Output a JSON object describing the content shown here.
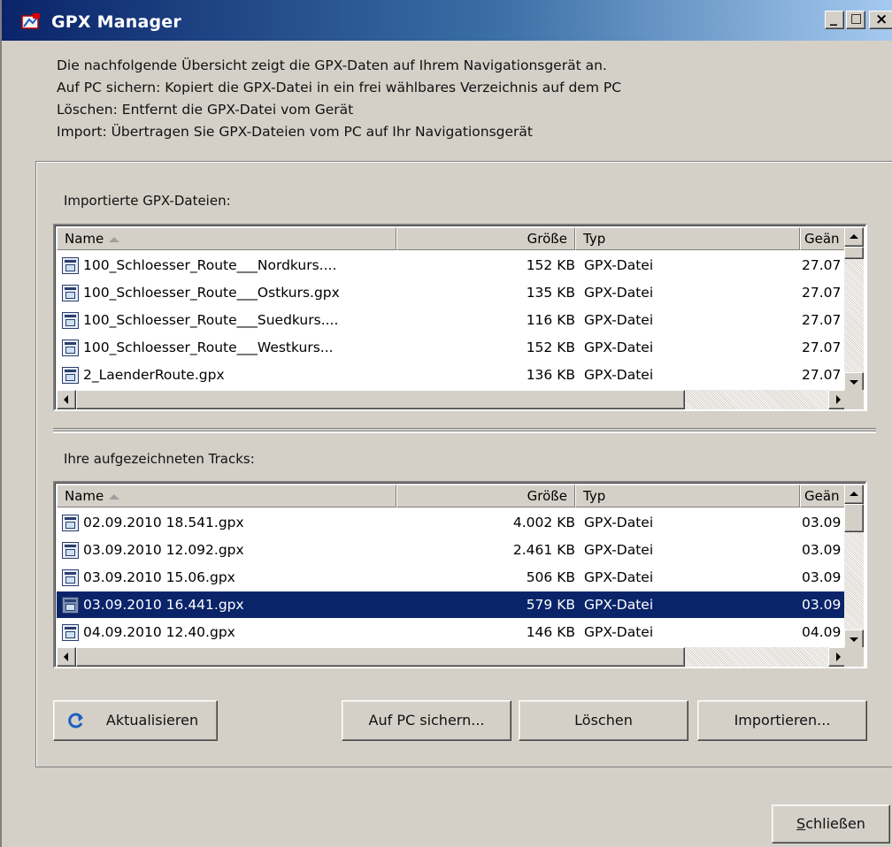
{
  "window": {
    "title": "GPX Manager",
    "controls": {
      "minimize": "_",
      "maximize": "□",
      "close": "×"
    }
  },
  "intro": {
    "lines": [
      "Die nachfolgende Übersicht zeigt die GPX-Daten auf Ihrem Navigationsgerät an.",
      "Auf PC sichern: Kopiert die GPX-Datei in ein frei wählbares Verzeichnis auf dem PC",
      "Löschen: Entfernt die GPX-Datei vom Gerät",
      "Import: Übertragen Sie GPX-Dateien vom PC auf Ihr Navigationsgerät"
    ]
  },
  "imported": {
    "label": "Importierte GPX-Dateien:",
    "columns": {
      "name": "Name",
      "size": "Größe",
      "type": "Typ",
      "date": "Geän"
    },
    "rows": [
      {
        "name": "100_Schloesser_Route___Nordkurs....",
        "size": "152 KB",
        "type": "GPX-Datei",
        "date": "27.07"
      },
      {
        "name": "100_Schloesser_Route___Ostkurs.gpx",
        "size": "135 KB",
        "type": "GPX-Datei",
        "date": "27.07"
      },
      {
        "name": "100_Schloesser_Route___Suedkurs....",
        "size": "116 KB",
        "type": "GPX-Datei",
        "date": "27.07"
      },
      {
        "name": "100_Schloesser_Route___Westkurs...",
        "size": "152 KB",
        "type": "GPX-Datei",
        "date": "27.07"
      },
      {
        "name": "2_LaenderRoute.gpx",
        "size": "136 KB",
        "type": "GPX-Datei",
        "date": "27.07"
      }
    ]
  },
  "tracks": {
    "label": "Ihre aufgezeichneten Tracks:",
    "columns": {
      "name": "Name",
      "size": "Größe",
      "type": "Typ",
      "date": "Geän"
    },
    "rows": [
      {
        "name": "02.09.2010 18.541.gpx",
        "size": "4.002 KB",
        "type": "GPX-Datei",
        "date": "03.09"
      },
      {
        "name": "03.09.2010 12.092.gpx",
        "size": "2.461 KB",
        "type": "GPX-Datei",
        "date": "03.09"
      },
      {
        "name": "03.09.2010 15.06.gpx",
        "size": "506 KB",
        "type": "GPX-Datei",
        "date": "03.09"
      },
      {
        "name": "03.09.2010 16.441.gpx",
        "size": "579 KB",
        "type": "GPX-Datei",
        "date": "03.09",
        "selected": true
      },
      {
        "name": "04.09.2010 12.40.gpx",
        "size": "146 KB",
        "type": "GPX-Datei",
        "date": "04.09"
      }
    ],
    "selected_row": "03.09.2010 16.441.gpx"
  },
  "buttons": {
    "refresh": "Aktualisieren",
    "save_to_pc": "Auf PC sichern...",
    "delete": "Löschen",
    "import": "Importieren...",
    "close_prefix": "S",
    "close_rest": "chließen"
  },
  "colors": {
    "titlebar_start": "#0a246a",
    "titlebar_end": "#a6caf0",
    "face": "#d4d0c8",
    "selection": "#0a246a"
  }
}
